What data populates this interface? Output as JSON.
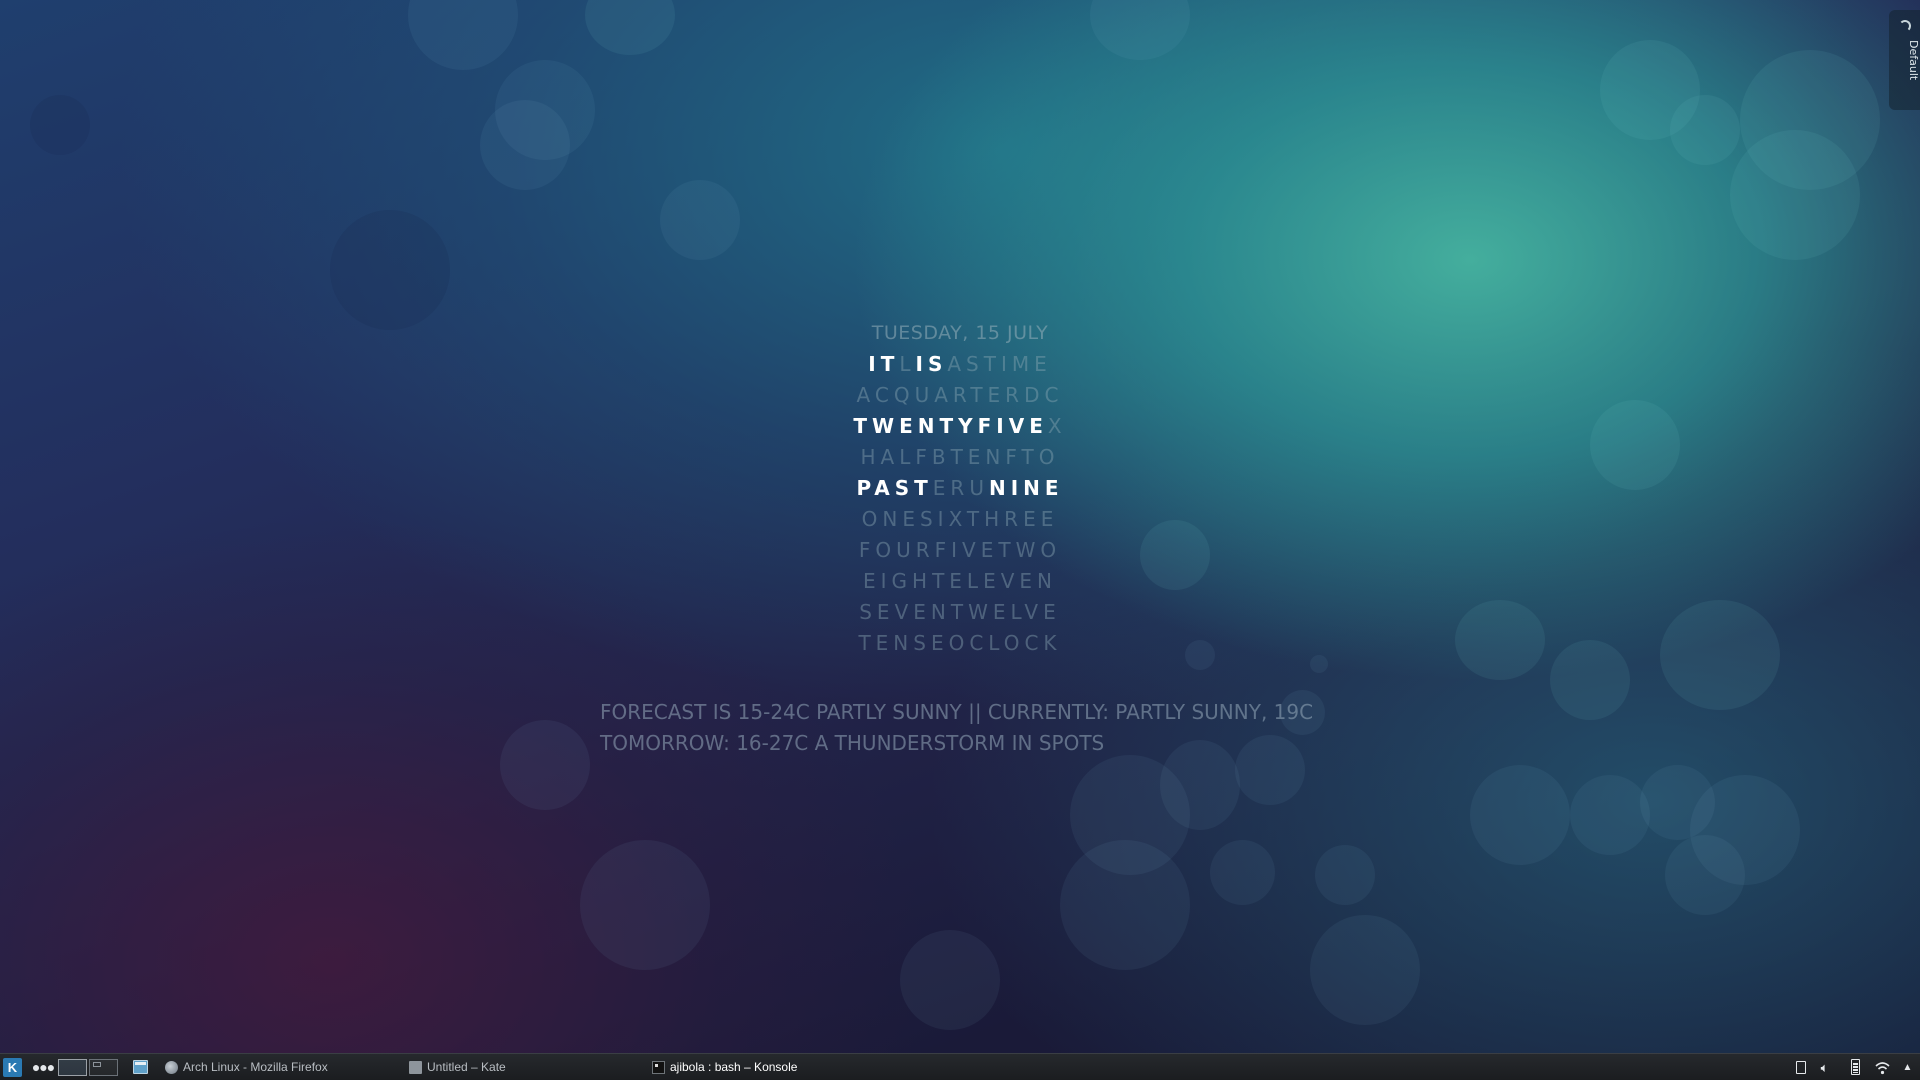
{
  "activity_tab": {
    "label": "Default",
    "icon": "activity-moon-icon"
  },
  "clock": {
    "date": "TUESDAY, 15 JULY",
    "rows": [
      [
        {
          "t": "IT",
          "lit": true
        },
        {
          "t": "L",
          "lit": false
        },
        {
          "t": "IS",
          "lit": true
        },
        {
          "t": "ASTIME",
          "lit": false
        }
      ],
      [
        {
          "t": "ACQUARTERDC",
          "lit": false
        }
      ],
      [
        {
          "t": "TWENTYFIVE",
          "lit": true
        },
        {
          "t": "X",
          "lit": false
        }
      ],
      [
        {
          "t": "HALFBTENFTO",
          "lit": false
        }
      ],
      [
        {
          "t": "PAST",
          "lit": true
        },
        {
          "t": "ERU",
          "lit": false
        },
        {
          "t": "NINE",
          "lit": true
        }
      ],
      [
        {
          "t": "ONESIXTHREE",
          "lit": false
        }
      ],
      [
        {
          "t": "FOURFIVETWO",
          "lit": false
        }
      ],
      [
        {
          "t": "EIGHTELEVEN",
          "lit": false
        }
      ],
      [
        {
          "t": "SEVENTWELVE",
          "lit": false
        }
      ],
      [
        {
          "t": "TENSEOCLOCK",
          "lit": false
        }
      ]
    ]
  },
  "forecast": {
    "line1": "FORECAST IS 15-24C PARTLY SUNNY || CURRENTLY: PARTLY SUNNY, 19C",
    "line2": "TOMORROW: 16-27C A THUNDERSTORM IN SPOTS"
  },
  "taskbar": {
    "launcher_icon": "kde-launcher-icon",
    "overflow_label": "●●●",
    "tasks": [
      {
        "label": "Arch Linux - Mozilla Firefox",
        "icon": "firefox-icon",
        "active": false
      },
      {
        "label": "Untitled – Kate",
        "icon": "kate-icon",
        "active": false
      },
      {
        "label": "ajibola : bash – Konsole",
        "icon": "konsole-icon",
        "active": true
      }
    ],
    "tray": [
      "clipboard-icon",
      "volume-icon",
      "battery-icon",
      "wifi-icon",
      "expand-arrow-icon"
    ]
  },
  "colors": {
    "lit_text": "#ffffff",
    "dim_text": "#8caab4",
    "taskbar_bg": "#1f2124",
    "launcher_blue": "#2a7ab3"
  }
}
